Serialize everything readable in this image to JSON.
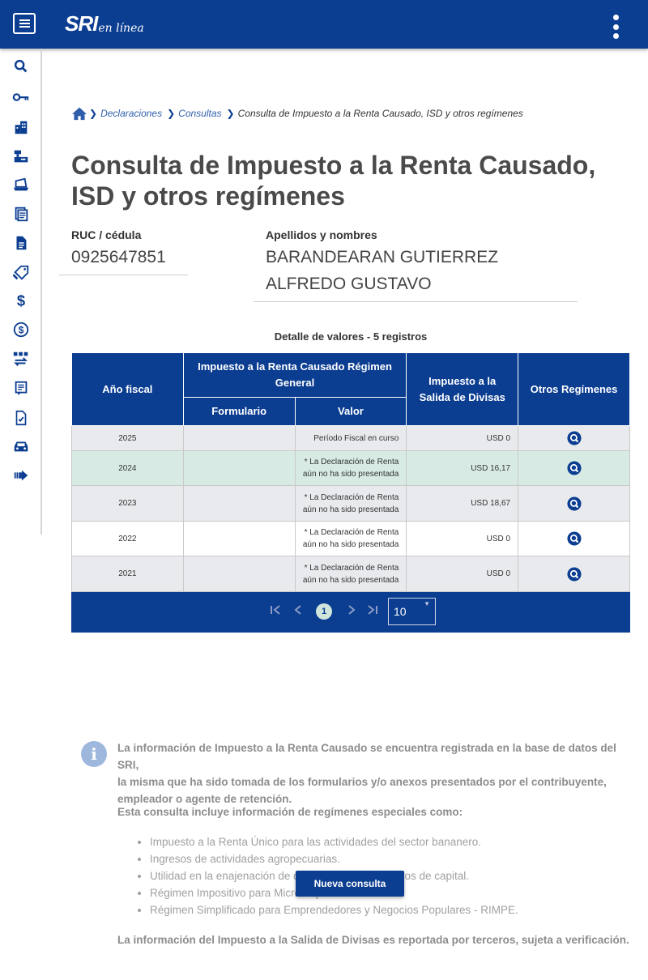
{
  "app": {
    "logo_brand": "SRI",
    "logo_suffix": "en línea",
    "brand_color": "#0b3d91"
  },
  "sidebar": {
    "items": [
      {
        "icon": "search-icon"
      },
      {
        "icon": "key-icon"
      },
      {
        "icon": "buildings-icon"
      },
      {
        "icon": "cash-register-icon"
      },
      {
        "icon": "laptop-inbox-icon"
      },
      {
        "icon": "documents-icon"
      },
      {
        "icon": "document-icon"
      },
      {
        "icon": "hand-tag-icon"
      },
      {
        "icon": "dollar-icon"
      },
      {
        "icon": "dollar-circle-icon"
      },
      {
        "icon": "exchange-icon"
      },
      {
        "icon": "forms-icon"
      },
      {
        "icon": "checklist-icon"
      },
      {
        "icon": "car-icon"
      },
      {
        "icon": "arrow-right-icon"
      }
    ]
  },
  "breadcrumb": {
    "items": [
      "Declaraciones",
      "Consultas"
    ],
    "current": "Consulta de Impuesto a la Renta Causado, ISD y otros regímenes"
  },
  "page": {
    "title": "Consulta de Impuesto a la Renta Causado, ISD y otros regímenes"
  },
  "taxpayer": {
    "id_label": "RUC / cédula",
    "id_value": "0925647851",
    "name_label": "Apellidos y nombres",
    "name_line1": "BARANDEARAN GUTIERREZ",
    "name_line2": "ALFREDO GUSTAVO"
  },
  "table": {
    "caption": "Detalle de valores - 5 registros",
    "headers": {
      "year": "Año fiscal",
      "group": "Impuesto a la Renta Causado Régimen General",
      "form": "Formulario",
      "value": "Valor",
      "isd": "Impuesto a la Salida de Divisas",
      "others": "Otros Regímenes"
    },
    "rows": [
      {
        "year": "2025",
        "form": "",
        "value_line1": "Período Fiscal en curso",
        "value_line2": "",
        "isd": "USD 0"
      },
      {
        "year": "2024",
        "form": "",
        "value_line1": "* La Declaración de Renta",
        "value_line2": "aún no ha sido presentada",
        "isd": "USD 16,17"
      },
      {
        "year": "2023",
        "form": "",
        "value_line1": "* La Declaración de Renta",
        "value_line2": "aún no ha sido presentada",
        "isd": "USD 18,67"
      },
      {
        "year": "2022",
        "form": "",
        "value_line1": "* La Declaración de Renta",
        "value_line2": "aún no ha sido presentada",
        "isd": "USD 0"
      },
      {
        "year": "2021",
        "form": "",
        "value_line1": "* La Declaración de Renta",
        "value_line2": "aún no ha sido presentada",
        "isd": "USD 0"
      }
    ],
    "pagination": {
      "current_page": "1",
      "page_size": "10"
    }
  },
  "info": {
    "paragraph1_line1": "La información de Impuesto a la Renta Causado se encuentra registrada en la base de datos del SRI,",
    "paragraph1_line2": "la misma que ha sido tomada de los formularios y/o anexos presentados por el contribuyente,",
    "paragraph1_line3": "empleador o agente de retención.",
    "paragraph2": "Esta consulta incluye información de regímenes especiales como:",
    "list": [
      "Impuesto a la Renta Único para las actividades del sector bananero.",
      "Ingresos de actividades agropecuarias.",
      "Utilidad en la enajenación de derechos representativos de capital.",
      "Régimen Impositivo para Microempresas.",
      "Régimen Simplificado para Emprendedores y Negocios Populares - RIMPE."
    ],
    "paragraph3": "La información del Impuesto a la Salida de Divisas es reportada por terceros, sujeta a verificación."
  },
  "actions": {
    "new_query": "Nueva consulta"
  }
}
